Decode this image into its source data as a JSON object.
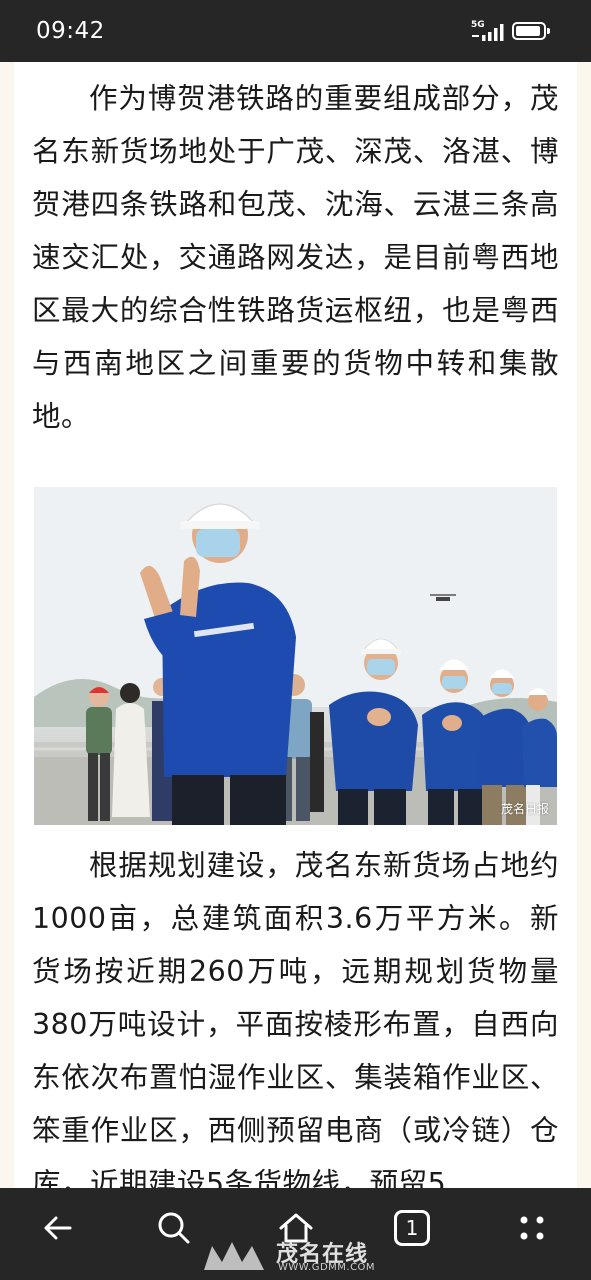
{
  "status_bar": {
    "time": "09:42",
    "network": "5G",
    "colors": {
      "background": "#262626",
      "foreground": "#ffffff"
    }
  },
  "article": {
    "paragraph_1": "作为博贺港铁路的重要组成部分，茂名东新货场地处于广茂、深茂、洛湛、博贺港四条铁路和包茂、沈海、云湛三条高速交汇处，交通路网发达，是目前粤西地区最大的综合性铁路货运枢纽，也是粤西与西南地区之间重要的货物中转和集散地。",
    "photo": {
      "credit": "茂名日报",
      "icons": [
        "workers-in-hardhats",
        "drone-icon"
      ]
    },
    "paragraph_2": "根据规划建设，茂名东新货场占地约1000亩，总建筑面积3.6万平方米。新货场按近期260万吨，远期规划货物量380万吨设计，平面按棱形布置，自西向东依次布置怕湿作业区、集装箱作业区、笨重作业区，西侧预留电商（或冷链）仓库，近期建设5条货物线，预留5"
  },
  "nav_bar": {
    "tab_count": "1",
    "icons": [
      "back-arrow-icon",
      "search-icon",
      "home-icon",
      "tabs-icon",
      "menu-dots-icon"
    ]
  },
  "watermark": {
    "brand": "茂名在线",
    "site": "WWW.GDMM.COM"
  }
}
